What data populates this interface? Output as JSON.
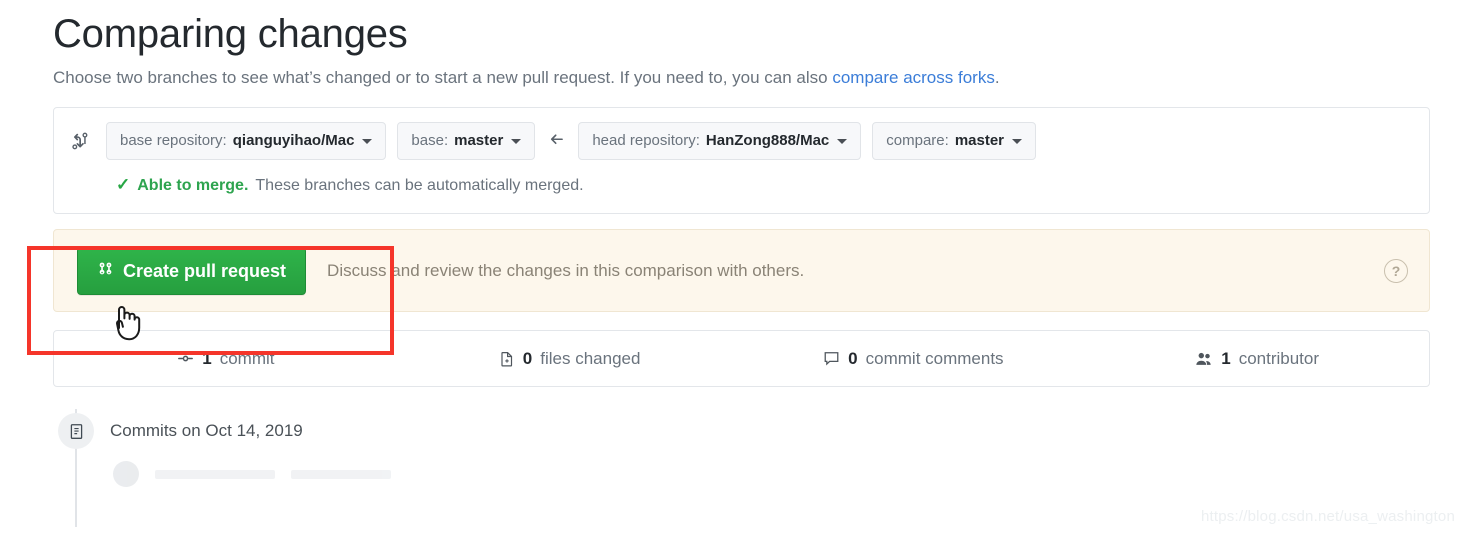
{
  "header": {
    "title": "Comparing changes",
    "subtitle_before": "Choose two branches to see what’s changed or to start a new pull request. If you need to, you can also ",
    "subtitle_link": "compare across forks",
    "subtitle_after": "."
  },
  "branch_bar": {
    "compare_icon": "git-compare-icon",
    "base_repository": {
      "label": "base repository:",
      "value": "qianguyihao/Mac"
    },
    "base_branch": {
      "label": "base:",
      "value": "master"
    },
    "direction_arrow": "arrow-left-icon",
    "head_repository": {
      "label": "head repository:",
      "value": "HanZong888/Mac"
    },
    "compare_branch": {
      "label": "compare:",
      "value": "master"
    }
  },
  "merge_status": {
    "check_icon": "check-icon",
    "status": "Able to merge.",
    "detail": "These branches can be automatically merged."
  },
  "create_pr": {
    "button_icon": "git-pull-request-icon",
    "button_label": "Create pull request",
    "description": "Discuss and review the changes in this comparison with others.",
    "help_icon": "question-mark-icon",
    "help_label": "?",
    "button_color": "#28a745",
    "panel_color": "#fdf7ec"
  },
  "stats": [
    {
      "icon": "commit-icon",
      "number": "1",
      "label": "commit"
    },
    {
      "icon": "file-diff-icon",
      "number": "0",
      "label": "files changed"
    },
    {
      "icon": "comment-icon",
      "number": "0",
      "label": "commit comments"
    },
    {
      "icon": "people-icon",
      "number": "1",
      "label": "contributor"
    }
  ],
  "timeline": {
    "group_icon": "commit-group-icon",
    "group_label": "Commits on Oct 14, 2019"
  },
  "annotation": {
    "box_color": "#f5352a",
    "cursor_icon": "pointing-hand-cursor"
  },
  "watermark": {
    "text": "https://blog.csdn.net/usa_washington"
  }
}
